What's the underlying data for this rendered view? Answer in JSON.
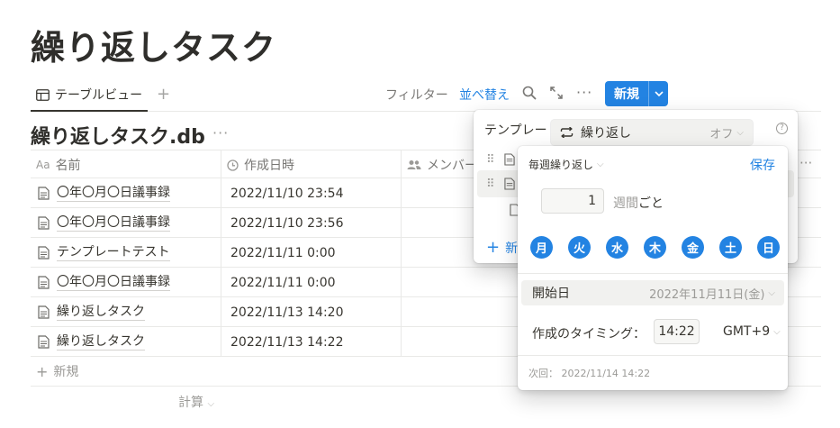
{
  "page": {
    "title": "繰り返しタスク"
  },
  "viewbar": {
    "tab_label": "テーブルビュー",
    "add": "+",
    "filter": "フィルター",
    "sort": "並べ替え",
    "more": "···",
    "new_button": "新規"
  },
  "database": {
    "title": "繰り返しタスク.db",
    "more": "···"
  },
  "table": {
    "headers": {
      "name_prefix": "Aa",
      "name": "名前",
      "created": "作成日時",
      "member": "メンバー"
    },
    "rows": [
      {
        "name": "〇年〇月〇日議事録",
        "created": "2022/11/10 23:54"
      },
      {
        "name": "〇年〇月〇日議事録",
        "created": "2022/11/10 23:56"
      },
      {
        "name": "テンプレートテスト",
        "created": "2022/11/11 0:00"
      },
      {
        "name": "〇年〇月〇日議事録",
        "created": "2022/11/11 0:00"
      },
      {
        "name": "繰り返しタスク",
        "created": "2022/11/13 14:20"
      },
      {
        "name": "繰り返しタスク",
        "created": "2022/11/13 14:22"
      }
    ],
    "new_row": "新規",
    "calc": "計算",
    "header_more": "···"
  },
  "template_popup": {
    "heading": "テンプレー",
    "help": "?",
    "new_label": "新"
  },
  "recurrence_select": {
    "label": "繰り返し",
    "value": "オフ"
  },
  "recurrence_popup": {
    "frequency": "毎週繰り返し",
    "save": "保存",
    "interval_value": "1",
    "interval_unit": "週間",
    "interval_suffix": "ごと",
    "days": [
      "月",
      "火",
      "水",
      "木",
      "金",
      "土",
      "日"
    ],
    "start_label": "開始日",
    "start_value": "2022年11月11日(金)",
    "timing_label": "作成のタイミング：",
    "time_value": "14:22",
    "timezone": "GMT+9",
    "next_label": "次回：",
    "next_value": "2022/11/14 14:22"
  },
  "colors": {
    "accent": "#2383e2",
    "text": "#37352f",
    "muted": "#9b9a97"
  }
}
